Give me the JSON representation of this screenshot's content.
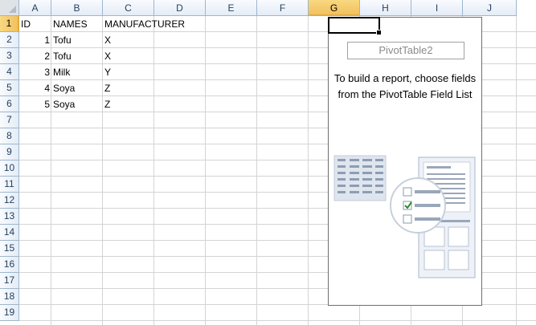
{
  "columns": [
    "A",
    "B",
    "C",
    "D",
    "E",
    "F",
    "G",
    "H",
    "I",
    "J"
  ],
  "selected_column": "G",
  "rows": [
    "1",
    "2",
    "3",
    "4",
    "5",
    "6",
    "7",
    "8",
    "9",
    "10",
    "11",
    "12",
    "13",
    "14",
    "15",
    "16",
    "17",
    "18",
    "19"
  ],
  "selected_row": "1",
  "table": {
    "headers": [
      "ID",
      "NAMES",
      "MANUFACTURER"
    ],
    "records": [
      [
        "1",
        "Tofu",
        "X"
      ],
      [
        "2",
        "Tofu",
        "X"
      ],
      [
        "3",
        "Milk",
        "Y"
      ],
      [
        "4",
        "Soya",
        "Z"
      ],
      [
        "5",
        "Soya",
        "Z"
      ]
    ]
  },
  "pivot": {
    "name": "PivotTable2",
    "instructions": "To build a report, choose fields from the PivotTable Field List"
  },
  "icons": {
    "field_list": "pivot-field-list-illustration-icon",
    "checkbox_checked": "checkbox-checked-icon"
  },
  "colors": {
    "selected_header": "#f1c15f",
    "header_border": "#9eb6ce",
    "gridline": "#d4d4d4",
    "checkmark": "#2e8b2e"
  }
}
